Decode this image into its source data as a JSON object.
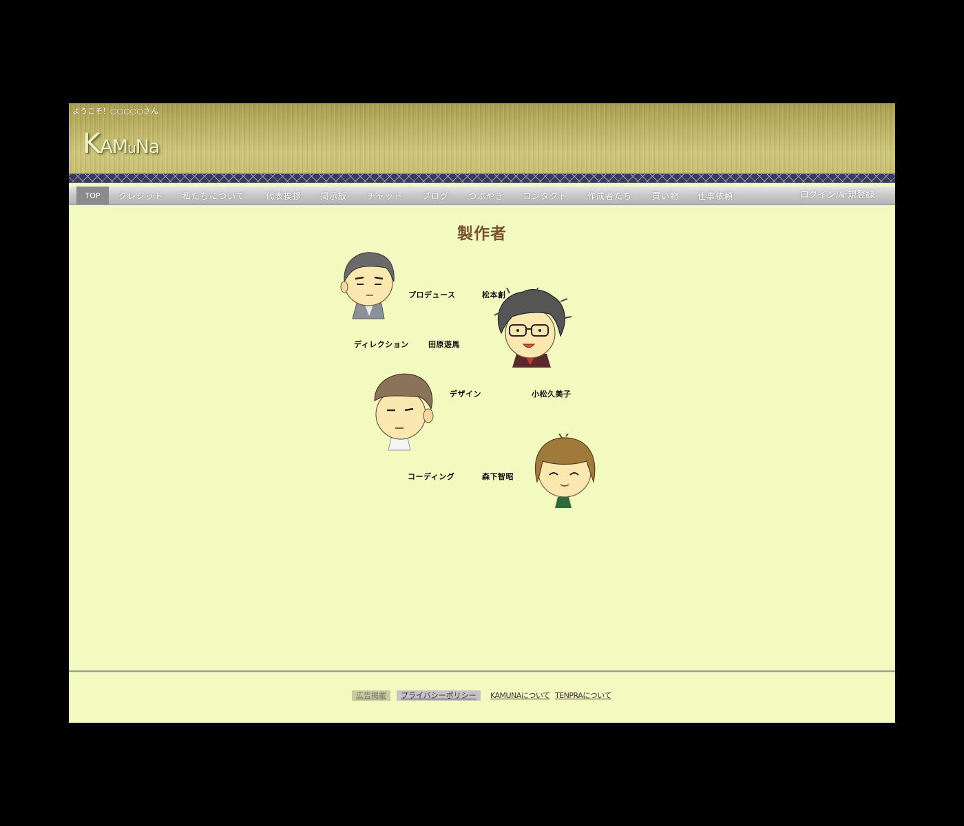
{
  "header": {
    "welcome": "ようこそ！○○○○○さん",
    "logo": {
      "k": "K",
      "a1": "A",
      "m": "M",
      "u": "u",
      "n": "N",
      "a2": "a"
    }
  },
  "nav": {
    "items": [
      "TOP",
      "クレジット",
      "私たちについて",
      "代表挨拶",
      "掲示板",
      "チャット",
      "ブログ",
      "つぶやき",
      "コンタクト",
      "作成者たち",
      "買い物",
      "仕事依頼"
    ],
    "active": "TOP",
    "login": "ログイン/新規登録"
  },
  "main": {
    "title": "製作者",
    "credits": [
      {
        "role": "プロデュース",
        "name": "松本創"
      },
      {
        "role": "ディレクション",
        "name": "田原遊馬"
      },
      {
        "role": "デザイン",
        "name": "小松久美子"
      },
      {
        "role": "コーディング",
        "name": "森下智昭"
      }
    ]
  },
  "footer": {
    "links": [
      "広告掲載",
      "プライバシーポリシー",
      "KAMUNAについて",
      "TENPRAについて"
    ]
  },
  "colors": {
    "background": "#f2fac0",
    "title": "#7a5230",
    "outer": "#000000"
  }
}
